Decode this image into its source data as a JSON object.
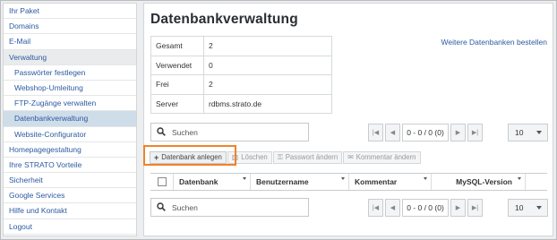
{
  "sidebar": {
    "items": [
      {
        "label": "Ihr Paket"
      },
      {
        "label": "Domains"
      },
      {
        "label": "E-Mail"
      },
      {
        "label": "Verwaltung"
      },
      {
        "label": "Passwörter festlegen"
      },
      {
        "label": "Webshop-Umleitung"
      },
      {
        "label": "FTP-Zugänge verwalten"
      },
      {
        "label": "Datenbankverwaltung"
      },
      {
        "label": "Website-Configurator"
      },
      {
        "label": "Homepagegestaltung"
      },
      {
        "label": "Ihre STRATO Vorteile"
      },
      {
        "label": "Sicherheit"
      },
      {
        "label": "Google Services"
      },
      {
        "label": "Hilfe und Kontakt"
      },
      {
        "label": "Logout"
      }
    ]
  },
  "main": {
    "title": "Datenbankverwaltung",
    "more_link": "Weitere Datenbanken bestellen",
    "info": [
      {
        "key": "Gesamt",
        "value": "2"
      },
      {
        "key": "Verwendet",
        "value": "0"
      },
      {
        "key": "Frei",
        "value": "2"
      },
      {
        "key": "Server",
        "value": "rdbms.strato.de"
      }
    ]
  },
  "search": {
    "placeholder": "Suchen"
  },
  "pager": {
    "info": "0 - 0 / 0 (0)",
    "per_page": "10"
  },
  "toolbar": {
    "create": "Datenbank anlegen",
    "delete": "Löschen",
    "change_password": "Passwort ändern",
    "change_comment": "Kommentar ändern"
  },
  "grid": {
    "columns": [
      "Datenbank",
      "Benutzername",
      "Kommentar",
      "MySQL-Version"
    ]
  },
  "colors": {
    "highlight": "#f0822a",
    "link": "#2c5aa0",
    "active_item": "#cfdde9"
  }
}
